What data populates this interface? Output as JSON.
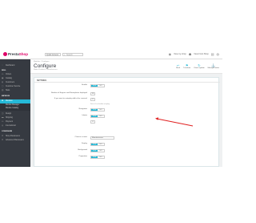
{
  "header": {
    "logo_pre": "Presta",
    "logo_brand": "Shop",
    "shop_select": "Quick Access",
    "search_placeholder": "Search",
    "right_items": [
      "View my shop",
      "View Front Shop"
    ]
  },
  "sidebar": {
    "items_top": [
      "Dashboard",
      "Orders",
      "Catalog",
      "Customers",
      "Customer Service",
      "Stats"
    ],
    "section_label": "Modules",
    "active": "Modules",
    "subitems": [
      "Module Manager",
      "Module Catalog"
    ],
    "items_bottom": [
      "Design",
      "Shipping",
      "Payment",
      "International",
      "Shop Parameters"
    ],
    "footer": "Advanced Parameters"
  },
  "page": {
    "breadcrumb": "Modules / Configure",
    "title": "Configure",
    "subtitle": "Slider Products / Manufacturer",
    "toolbar": [
      "Back",
      "Translate",
      "Check update",
      "Manage hooks"
    ]
  },
  "panel": {
    "title": "SETTINGS",
    "rows": [
      {
        "label": "Enable",
        "type": "toggle",
        "on": "YES",
        "off": "NO"
      },
      {
        "label": "Number of Engines and Nameplates displayed",
        "type": "number",
        "value": "10"
      },
      {
        "label": "If you want to autoplay add to the carousel",
        "type": "number",
        "value": "0"
      },
      {
        "label": "",
        "type": "help",
        "text": "Set to 0 to disable autoplay"
      },
      {
        "label": "Navigation",
        "type": "toggle",
        "on": "YES",
        "off": "NO"
      },
      {
        "label": "Infinite",
        "type": "toggle",
        "on": "YES",
        "off": "NO"
      },
      {
        "label": "",
        "type": "number",
        "value": "0"
      },
      {
        "label": "Choose a name",
        "type": "select",
        "value": "Manufacturers"
      },
      {
        "label": "Display",
        "type": "toggle",
        "on": "YES",
        "off": "NO"
      },
      {
        "label": "Background",
        "type": "toggle",
        "on": "YES",
        "off": "NO"
      },
      {
        "label": "Pagination",
        "type": "toggle",
        "on": "YES",
        "off": "NO"
      }
    ]
  },
  "colors": {
    "accent": "#25b9d7",
    "sidebar": "#363a41",
    "brand": "#df0067",
    "arrow": "#e02020"
  }
}
